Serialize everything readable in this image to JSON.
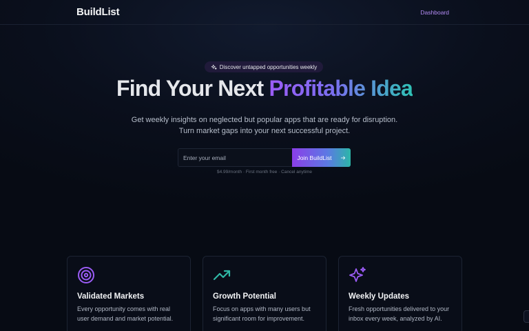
{
  "nav": {
    "logo": "BuildList",
    "dashboard_link": "Dashboard"
  },
  "hero": {
    "badge": "Discover untapped opportunities weekly",
    "headline_plain": "Find Your Next ",
    "headline_highlight": "Profitable Idea",
    "subtitle_line1": "Get weekly insights on neglected but popular apps that are ready for disruption.",
    "subtitle_line2": "Turn market gaps into your next successful project."
  },
  "signup": {
    "email_placeholder": "Enter your email",
    "email_value": "",
    "button_label": "Join BuildList",
    "pricing_note": "$4.99/month · First month free · Cancel anytime"
  },
  "features": [
    {
      "icon": "target-icon",
      "title": "Validated Markets",
      "description": "Every opportunity comes with real user demand and market potential."
    },
    {
      "icon": "trending-up-icon",
      "title": "Growth Potential",
      "description": "Focus on apps with many users but significant room for improvement."
    },
    {
      "icon": "sparkles-icon",
      "title": "Weekly Updates",
      "description": "Fresh opportunities delivered to your inbox every week, analyzed by AI."
    }
  ],
  "colors": {
    "background": "#0a0f1c",
    "accent_purple": "#9b5cf6",
    "accent_teal": "#2fc2b5",
    "nav_link": "#b48cf5"
  }
}
